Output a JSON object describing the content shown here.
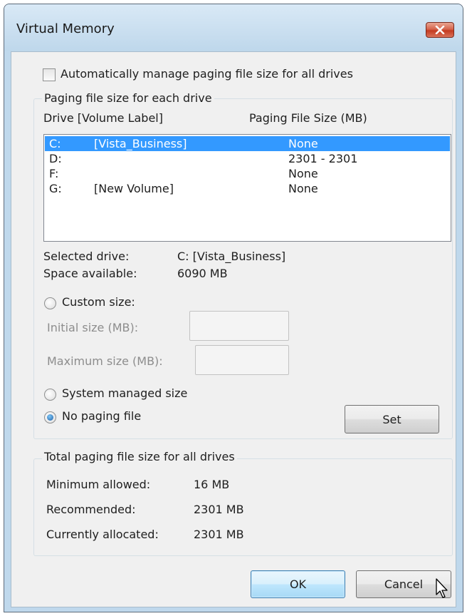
{
  "window": {
    "title": "Virtual Memory"
  },
  "auto_manage": {
    "label": "Automatically manage paging file size for all drives",
    "checked": false
  },
  "paging_group": {
    "caption": "Paging file size for each drive",
    "col_drive": "Drive  [Volume Label]",
    "col_size": "Paging File Size (MB)",
    "rows": [
      {
        "drive": "C:",
        "label": "[Vista_Business]",
        "size": "None",
        "selected": true
      },
      {
        "drive": "D:",
        "label": "",
        "size": "2301 - 2301",
        "selected": false
      },
      {
        "drive": "F:",
        "label": "",
        "size": "None",
        "selected": false
      },
      {
        "drive": "G:",
        "label": "[New Volume]",
        "size": "None",
        "selected": false
      }
    ],
    "selected_drive_label": "Selected drive:",
    "selected_drive_value": "C:  [Vista_Business]",
    "space_label": "Space available:",
    "space_value": "6090 MB",
    "custom_size_label": "Custom size:",
    "initial_label": "Initial size (MB):",
    "initial_value": "",
    "maximum_label": "Maximum size (MB):",
    "maximum_value": "",
    "system_managed_label": "System managed size",
    "no_paging_label": "No paging file",
    "selected_option": "no_paging",
    "set_label": "Set"
  },
  "total_group": {
    "caption": "Total paging file size for all drives",
    "min_label": "Minimum allowed:",
    "min_value": "16 MB",
    "rec_label": "Recommended:",
    "rec_value": "2301 MB",
    "cur_label": "Currently allocated:",
    "cur_value": "2301 MB"
  },
  "buttons": {
    "ok": "OK",
    "cancel": "Cancel"
  },
  "colors": {
    "selection": "#3399ff",
    "close_button": "#c43b20",
    "title_bar": "#bfd8ec"
  },
  "icons": {
    "close": "close-x-icon",
    "cursor": "mouse-pointer-icon"
  }
}
